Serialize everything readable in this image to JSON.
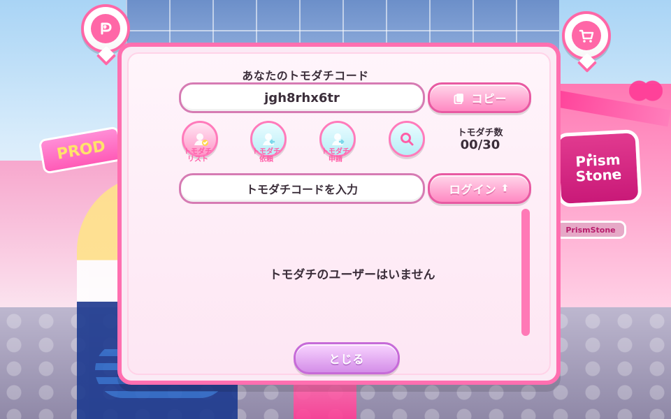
{
  "ui": {
    "title": "あなたのトモダチコード",
    "friend_code": "jgh8rhx6tr",
    "buttons": {
      "copy": "コピー",
      "login": "ログイン",
      "close": "とじる"
    },
    "input_placeholder": "トモダチコードを入力",
    "actions": [
      {
        "label_line1": "トモダチ",
        "label_line2": "リスト"
      },
      {
        "label_line1": "トモダチ",
        "label_line2": "依頼"
      },
      {
        "label_line1": "トモダチ",
        "label_line2": "申請"
      }
    ],
    "friend_count": {
      "label": "トモダチ数",
      "value": "00/30"
    },
    "empty_message": "トモダチのユーザーはいません"
  },
  "background": {
    "left_sign": "PROD",
    "right_sign": "Prism\nStone",
    "right_small_sign": "PrismStone"
  },
  "colors": {
    "pink": "#ff6fb0",
    "deep_pink": "#e85aa2",
    "panel_bg": "#fbeaf5",
    "text_dark": "#3b2e3a",
    "cyan": "#b8eef7"
  },
  "icons": {
    "top_left_pin": "p-logo-icon",
    "top_right_pin": "shopping-cart-icon",
    "copy": "copy-icon",
    "friend_list": "friend-list-icon",
    "friend_request_received": "friend-request-received-icon",
    "friend_request_sent": "friend-request-sent-icon",
    "search": "search-icon",
    "login_arrow": "up-arrow-icon"
  }
}
